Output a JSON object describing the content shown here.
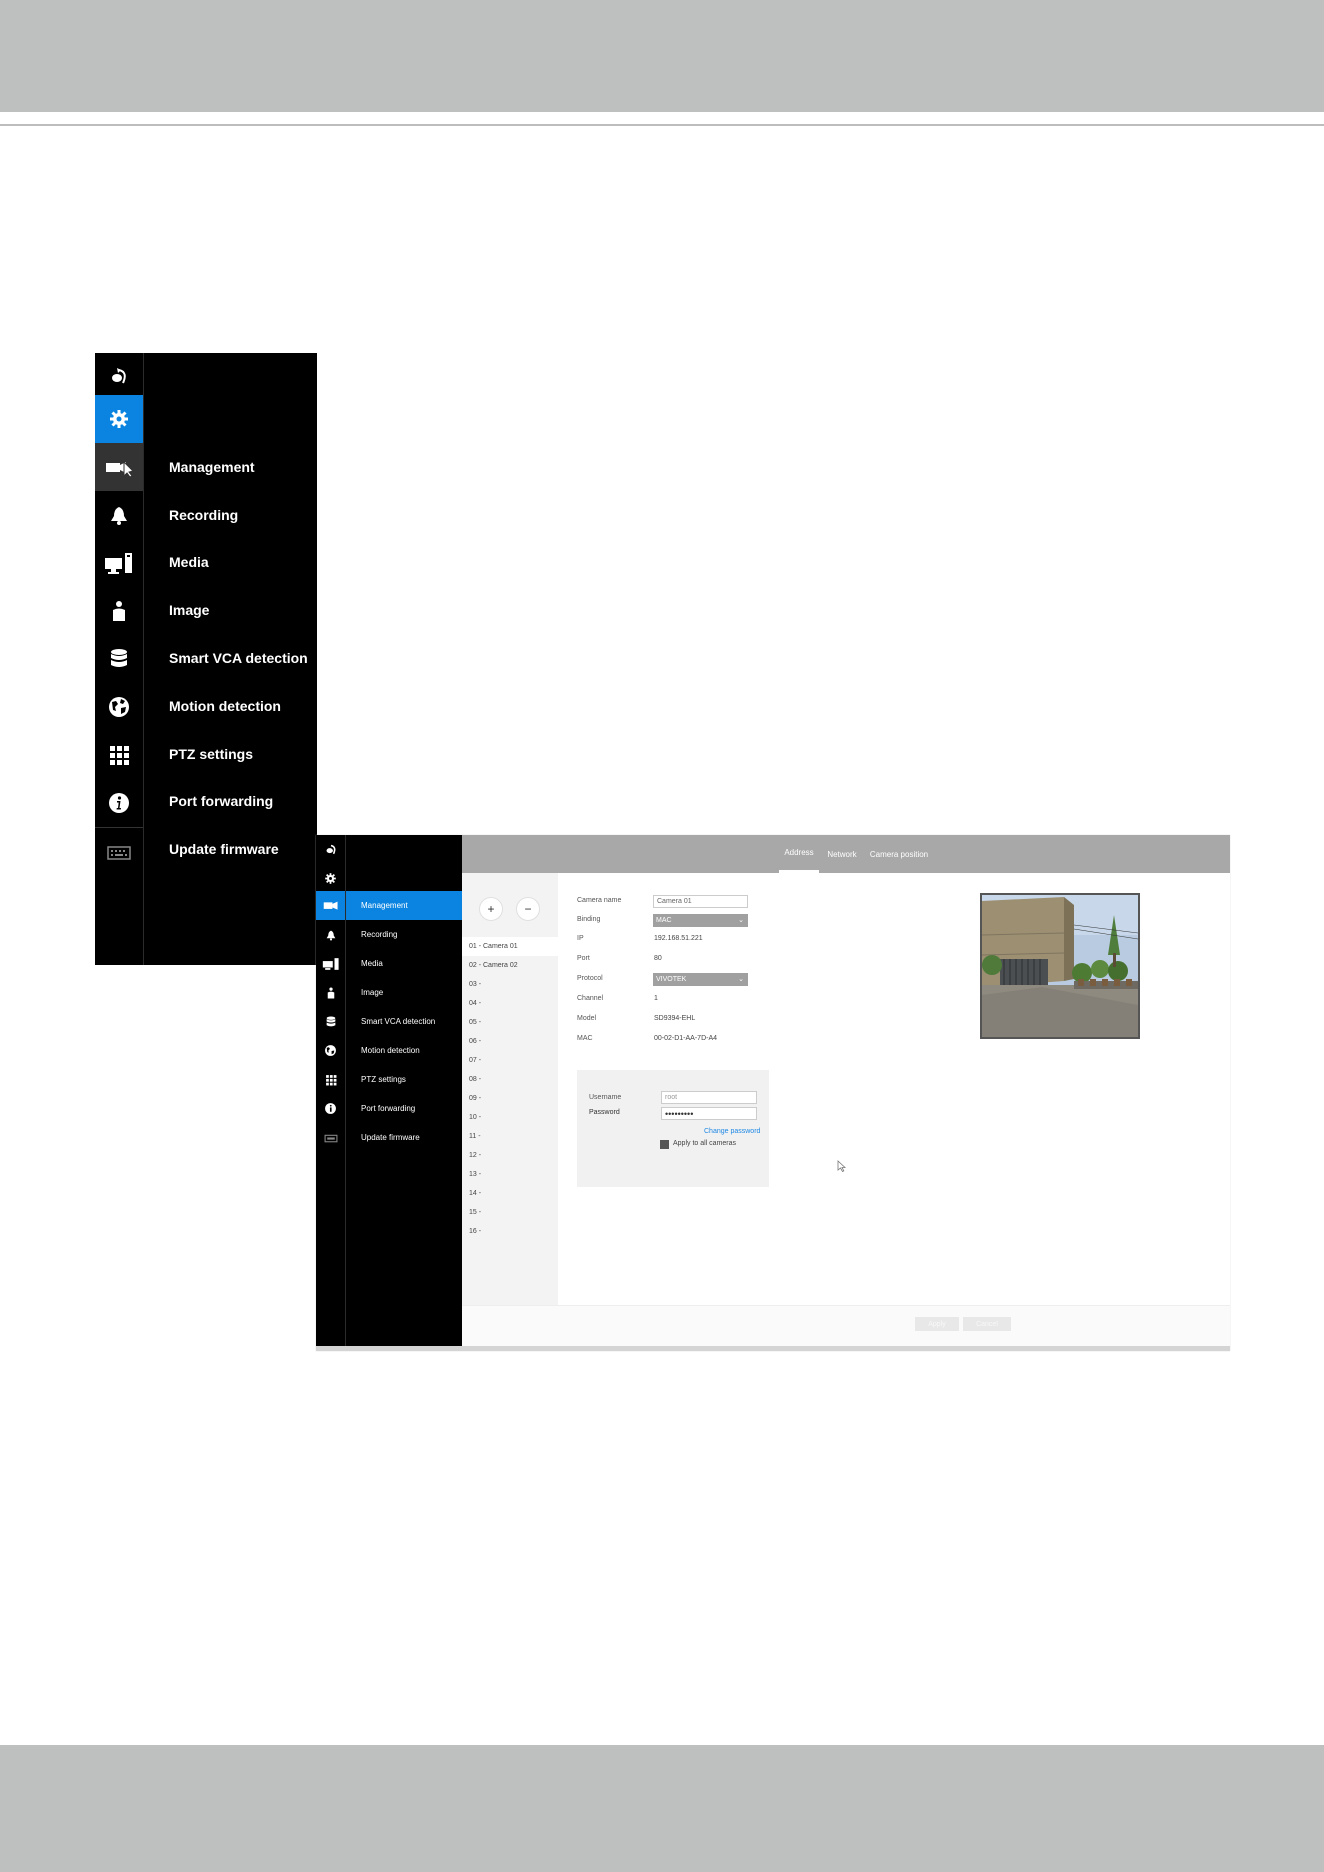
{
  "menu_large": {
    "items": [
      "Management",
      "Recording",
      "Media",
      "Image",
      "Smart VCA detection",
      "Motion detection",
      "PTZ settings",
      "Port forwarding",
      "Update firmware"
    ],
    "icons": [
      "back-icon",
      "gear-icon",
      "camera-icon",
      "bell-icon",
      "monitor-icon",
      "person-icon",
      "database-icon",
      "globe-icon",
      "grid-icon",
      "info-icon",
      "keyboard-icon"
    ]
  },
  "window": {
    "nav": [
      "Management",
      "Recording",
      "Media",
      "Image",
      "Smart VCA detection",
      "Motion detection",
      "PTZ settings",
      "Port forwarding",
      "Update firmware"
    ],
    "tabs": [
      "Address",
      "Network",
      "Camera position"
    ],
    "add_label": "+",
    "remove_label": "−",
    "cameras": [
      "01 - Camera 01",
      "02 - Camera 02",
      "03 -",
      "04 -",
      "05 -",
      "06 -",
      "07 -",
      "08 -",
      "09 -",
      "10 -",
      "11 -",
      "12 -",
      "13 -",
      "14 -",
      "15 -",
      "16 -"
    ],
    "form": {
      "camera_name_label": "Camera name",
      "camera_name_value": "Camera 01",
      "binding_label": "Binding",
      "binding_value": "MAC",
      "ip_label": "IP",
      "ip_value": "192.168.51.221",
      "port_label": "Port",
      "port_value": "80",
      "protocol_label": "Protocol",
      "protocol_value": "VIVOTEK",
      "channel_label": "Channel",
      "channel_value": "1",
      "model_label": "Model",
      "model_value": "SD9394-EHL",
      "mac_label": "MAC",
      "mac_value": "00-02-D1-AA-7D-A4"
    },
    "credentials": {
      "username_label": "Username",
      "username_value": "root",
      "password_label": "Password",
      "password_value": "•••••••••",
      "change_password": "Change password",
      "apply_all": "Apply to all cameras"
    },
    "buttons": {
      "apply": "Apply",
      "cancel": "Cancel"
    }
  },
  "colors": {
    "accent": "#0a84e0",
    "band": "#bebfbf"
  }
}
